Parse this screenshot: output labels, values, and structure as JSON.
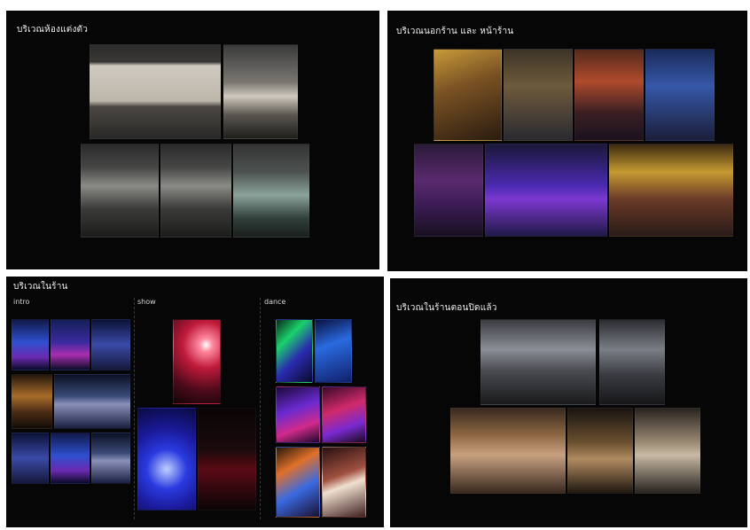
{
  "slides": [
    {
      "title": "บริเวณห้องแต่งตัว",
      "labels": []
    },
    {
      "title": "บริเวณนอกร้าน และ หน้าร้าน",
      "labels": []
    },
    {
      "title": "บริเวณในร้าน",
      "labels": [
        "intro",
        "show",
        "dance"
      ]
    },
    {
      "title": "บริเวณในร้านตอนปิดแล้ว",
      "labels": []
    }
  ],
  "photos": {
    "dressing_room": [
      "dressing-room-photo",
      "dressing-room-photo",
      "dressing-room-photo",
      "dressing-room-photo",
      "dressing-room-photo"
    ],
    "outside_front": [
      "street-photo",
      "street-photo",
      "street-photo",
      "street-photo",
      "storefront-photo",
      "storefront-photo",
      "storefront-photo"
    ],
    "inside_intro": [
      "intro-photo",
      "intro-photo",
      "intro-photo",
      "intro-photo",
      "intro-photo",
      "intro-photo",
      "intro-photo",
      "intro-photo"
    ],
    "inside_show": [
      "show-photo",
      "show-photo",
      "show-photo"
    ],
    "inside_dance": [
      "dance-photo",
      "dance-photo",
      "dance-photo",
      "dance-photo",
      "dance-photo",
      "dance-photo"
    ],
    "inside_closed": [
      "closed-photo",
      "closed-photo",
      "closed-photo",
      "closed-photo",
      "closed-photo"
    ]
  },
  "colors": {
    "slide_background": "#060606",
    "page_background": "#ffffff",
    "text": "#f2f2f2"
  }
}
